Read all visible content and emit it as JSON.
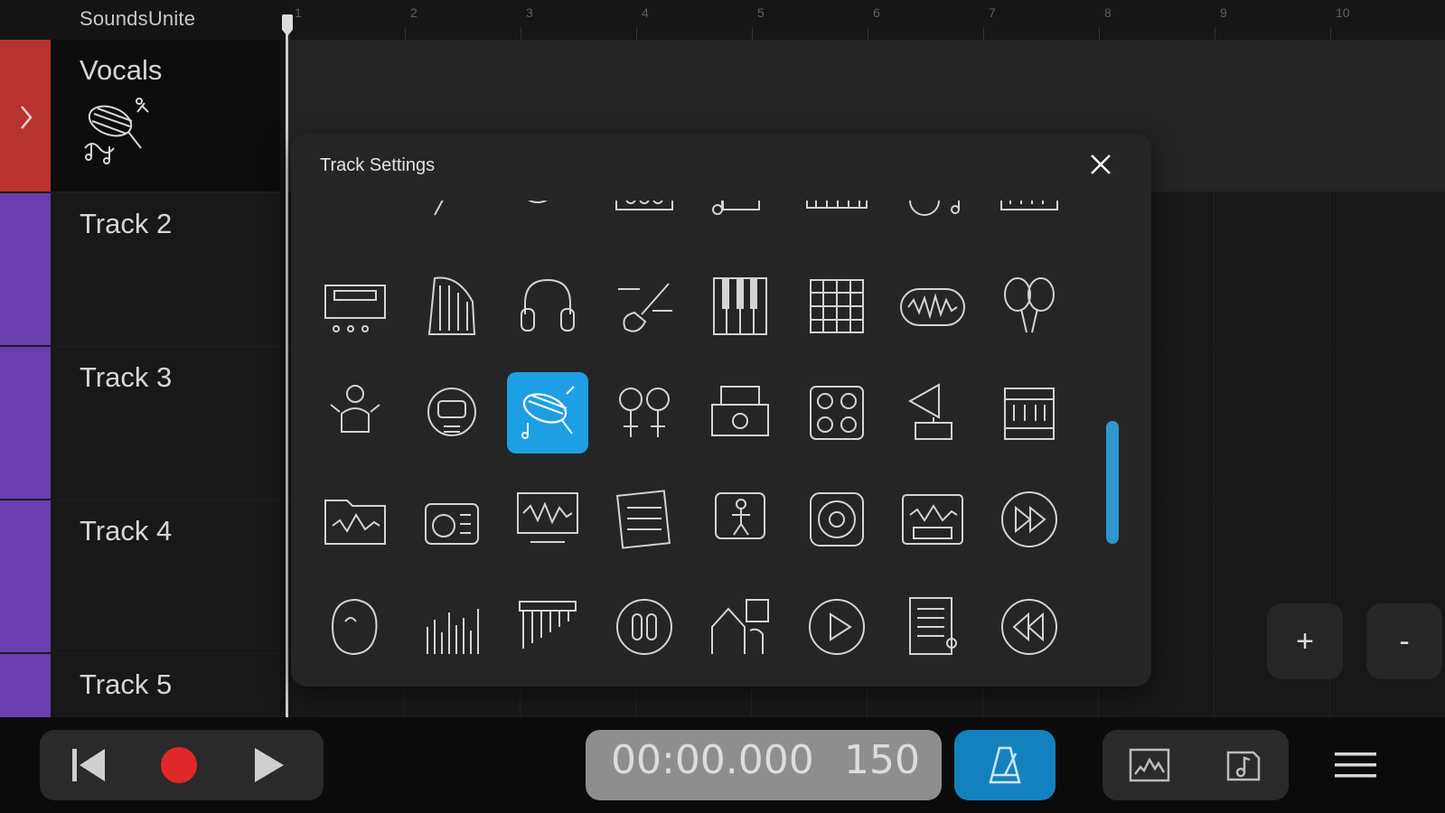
{
  "app": {
    "title": "SoundsUnite"
  },
  "ruler": {
    "numbers": [
      "1",
      "2",
      "3",
      "4",
      "5",
      "6",
      "7",
      "8",
      "9",
      "10"
    ]
  },
  "tracks": [
    {
      "name": "Vocals",
      "color": "#b8332f",
      "icon": "microphone-icon"
    },
    {
      "name": "Track 2",
      "color": "#6a3eb0"
    },
    {
      "name": "Track 3",
      "color": "#6a3eb0"
    },
    {
      "name": "Track 4",
      "color": "#6a3eb0"
    },
    {
      "name": "Track 5",
      "color": "#6a3eb0"
    }
  ],
  "modal": {
    "title": "Track Settings",
    "selected_icon": "microphone-icon",
    "icons": [
      [
        "cymbal-icon",
        "microphone-stick-icon",
        "tuba-icon",
        "amp-icon",
        "band-icon",
        "keyboard-icon",
        "guitar-note-icon",
        "mixer-icon"
      ],
      [
        "synth-icon",
        "harp-icon",
        "headphones-icon",
        "electric-guitar-icon",
        "piano-keys-icon",
        "drum-pad-icon",
        "loop-icon",
        "maracas-icon"
      ],
      [
        "singer-icon",
        "robot-head-icon",
        "microphone-icon",
        "gender-icon",
        "turntable-icon",
        "speaker-cabinet-icon",
        "gramophone-icon",
        "jukebox-icon"
      ],
      [
        "music-folder-icon",
        "radio-icon",
        "waveform-monitor-icon",
        "sheet-music-icon",
        "dancer-icon",
        "speaker-icon",
        "cassette-icon",
        "fast-forward-icon"
      ],
      [
        "face-icon",
        "equalizer-icon",
        "pan-flute-icon",
        "audio-split-icon",
        "stage-icon",
        "play-circle-icon",
        "score-sheet-icon",
        "rewind-icon"
      ]
    ]
  },
  "zoom": {
    "in_label": "+",
    "out_label": "-"
  },
  "transport": {
    "time": "00:00.000",
    "bpm": "150",
    "record_color": "#e02828",
    "metronome_color": "#1481bf"
  }
}
